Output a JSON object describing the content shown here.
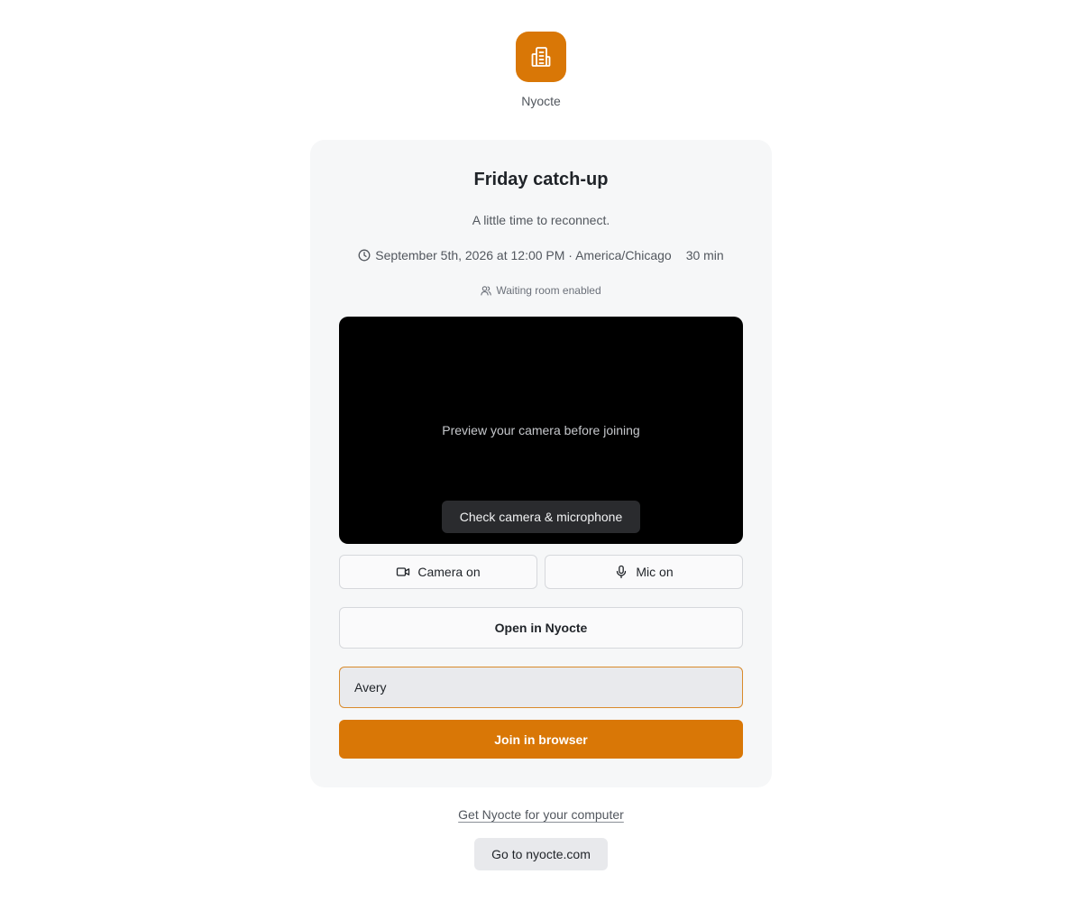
{
  "brand": {
    "name": "Nyocte",
    "logo_icon": "building-icon",
    "accent": "#d97706"
  },
  "meeting": {
    "title": "Friday catch-up",
    "description": "A little time to reconnect.",
    "datetime": "September 5th, 2026 at 12:00 PM · America/Chicago",
    "duration": "30 min",
    "waiting_room": "Waiting room enabled"
  },
  "preview": {
    "message": "Preview your camera before joining",
    "check_label": "Check camera & microphone"
  },
  "controls": {
    "camera_label": "Camera on",
    "camera_icon": "video-camera-icon",
    "mic_label": "Mic on",
    "mic_icon": "microphone-icon"
  },
  "actions": {
    "open_app_label": "Open in Nyocte",
    "name_value": "Avery",
    "join_label": "Join in browser"
  },
  "footer": {
    "download_link": "Get Nyocte for your computer",
    "site_button": "Go to nyocte.com"
  }
}
